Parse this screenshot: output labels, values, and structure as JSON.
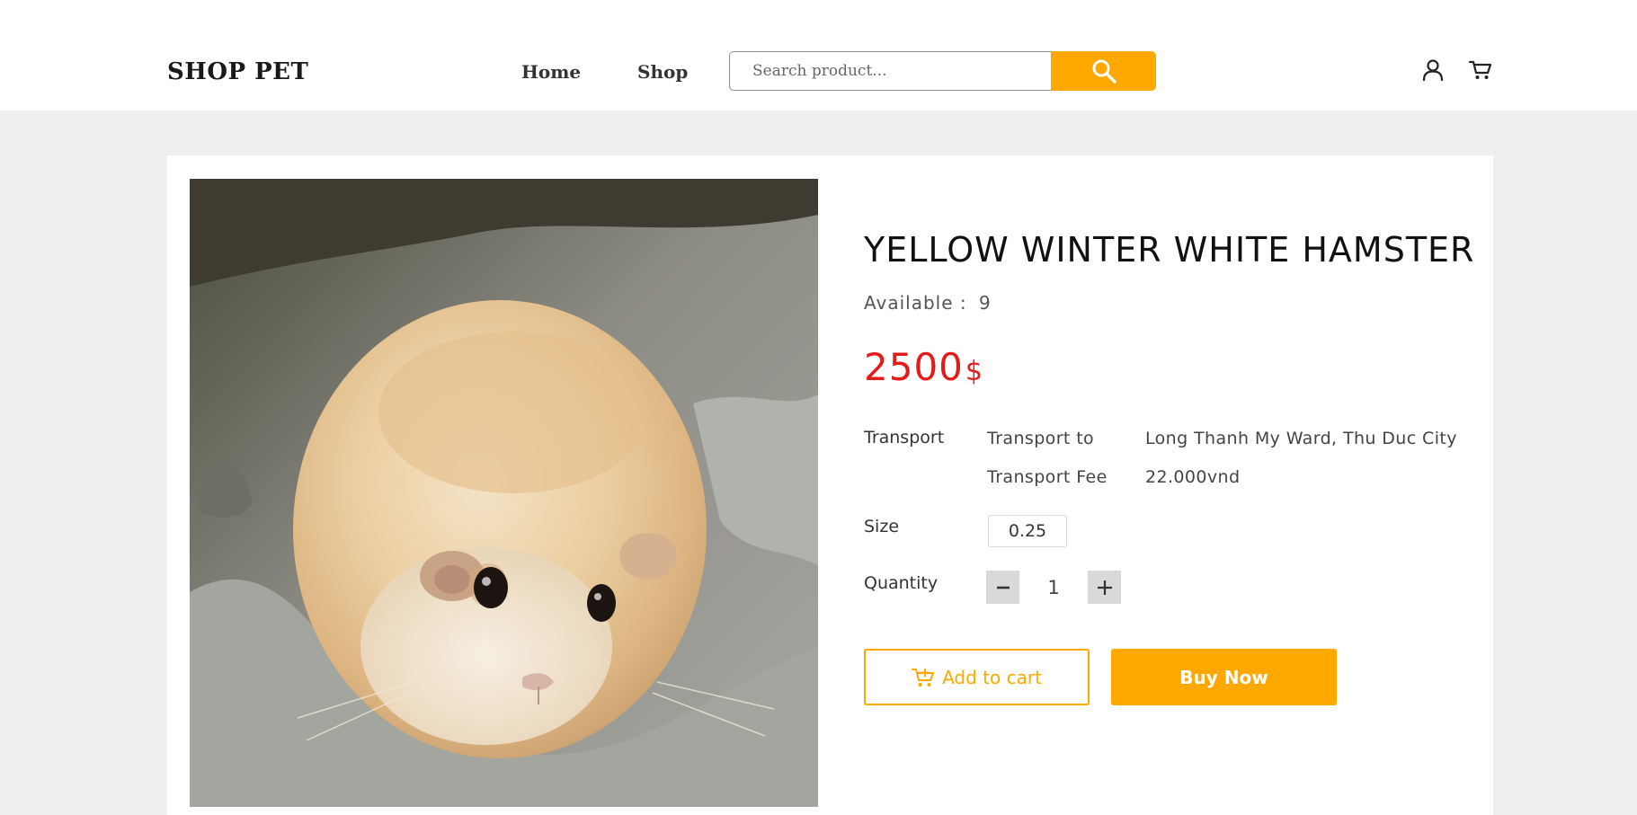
{
  "header": {
    "logo": "SHOP PET",
    "nav": [
      {
        "label": "Home"
      },
      {
        "label": "Shop"
      }
    ],
    "search": {
      "placeholder": "Search product...",
      "value": "",
      "button_icon": "search-icon"
    },
    "icons": [
      "user-icon",
      "cart-icon"
    ]
  },
  "product": {
    "image_alt": "hamster photo",
    "title": "YELLOW WINTER WHITE HAMSTER",
    "available_label": "Available :",
    "available_value": "9",
    "price_amount": "2500",
    "price_currency": "$",
    "transport": {
      "label": "Transport",
      "to_label": "Transport to",
      "to_value": "Long Thanh My Ward, Thu Duc City",
      "fee_label": "Transport Fee",
      "fee_value": "22.000vnd"
    },
    "size": {
      "label": "Size",
      "options": [
        "0.25"
      ]
    },
    "quantity": {
      "label": "Quantity",
      "value": "1"
    },
    "actions": {
      "add_to_cart": "Add to cart",
      "buy_now": "Buy Now"
    }
  },
  "colors": {
    "accent": "#ffa800",
    "price": "#e31b1b",
    "page_bg": "#efefef"
  }
}
